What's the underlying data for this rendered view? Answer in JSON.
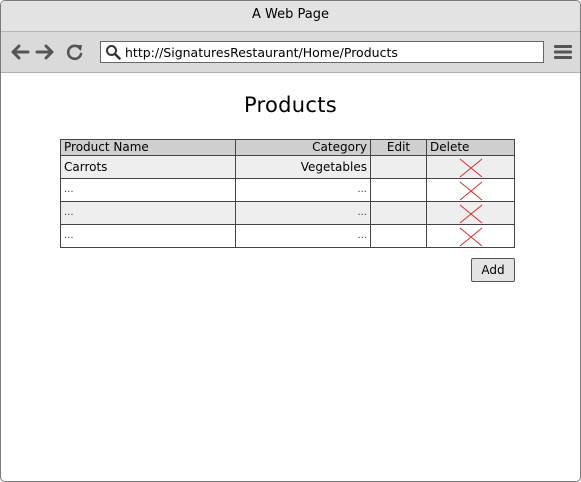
{
  "window": {
    "title": "A Web Page"
  },
  "browser": {
    "url": "http://SignaturesRestaurant/Home/Products",
    "back_icon": "arrow-left-icon",
    "forward_icon": "arrow-right-icon",
    "reload_icon": "reload-icon",
    "menu_icon": "hamburger-menu-icon"
  },
  "page": {
    "title": "Products",
    "add_label": "Add"
  },
  "table": {
    "headers": {
      "name": "Product Name",
      "category": "Category",
      "edit": "Edit",
      "delete": "Delete"
    },
    "rows": [
      {
        "name": "Carrots",
        "category": "Vegetables"
      },
      {
        "name": "...",
        "category": "..."
      },
      {
        "name": "...",
        "category": "..."
      },
      {
        "name": "...",
        "category": "..."
      }
    ],
    "delete_icon": "delete-x-icon",
    "delete_color": "#d03030"
  }
}
